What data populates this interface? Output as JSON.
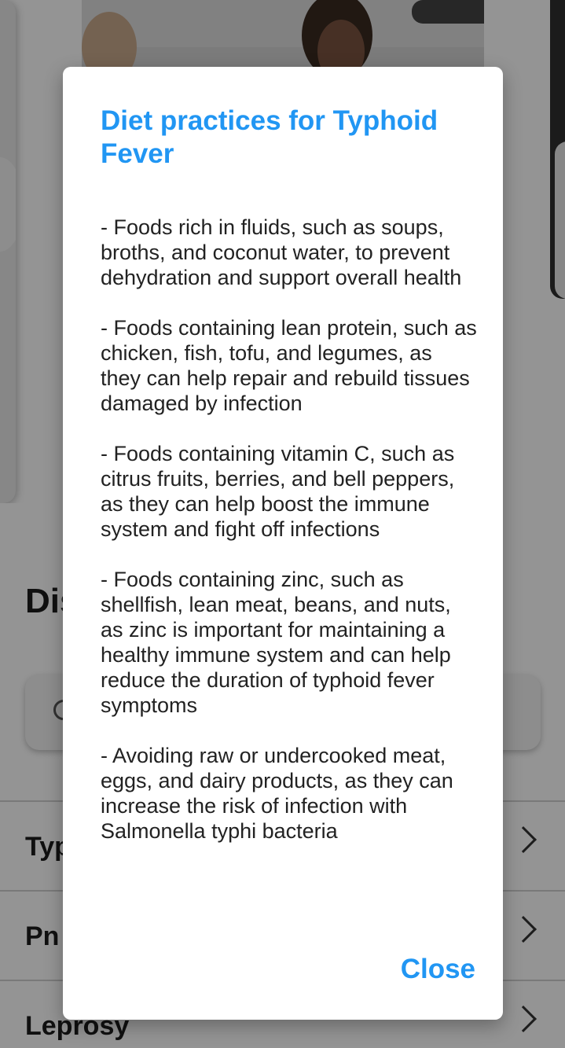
{
  "background": {
    "section_title": "Dis",
    "list_items": [
      {
        "label": "Typ"
      },
      {
        "label": "Pn"
      },
      {
        "label": "Leprosy"
      }
    ]
  },
  "dialog": {
    "title": "Diet practices for Typhoid Fever",
    "paragraphs": [
      "- Foods rich in fluids, such as soups, broths, and coconut water, to prevent dehydration and support overall health",
      "- Foods containing lean protein, such as chicken, fish, tofu, and legumes, as they can help repair and rebuild tissues damaged by infection",
      "- Foods containing vitamin C, such as citrus fruits, berries, and bell peppers, as they can help boost the immune system and fight off infections",
      "- Foods containing zinc, such as shellfish, lean meat, beans, and nuts, as zinc is important for maintaining a healthy immune system and can help reduce the duration of typhoid fever symptoms",
      "- Avoiding raw or undercooked meat, eggs, and dairy products, as they can increase the risk of infection with Salmonella typhi bacteria"
    ],
    "close_label": "Close"
  },
  "colors": {
    "accent": "#2196f3",
    "text": "#222222",
    "scrim": "rgba(0,0,0,0.42)"
  }
}
